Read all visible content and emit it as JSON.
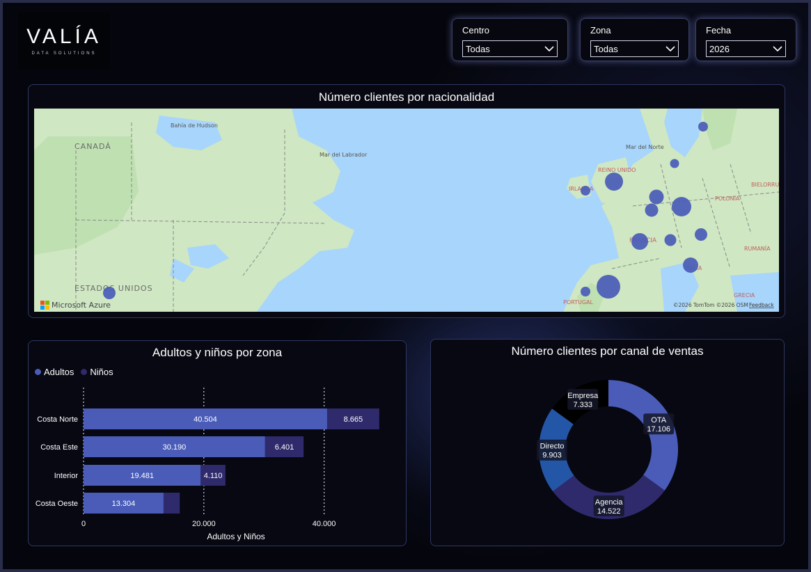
{
  "logo": {
    "main": "VALÍA",
    "sub": "DATA SOLUTIONS"
  },
  "slicers": [
    {
      "label": "Centro",
      "value": "Todas"
    },
    {
      "label": "Zona",
      "value": "Todas"
    },
    {
      "label": "Fecha",
      "value": "2026"
    }
  ],
  "map": {
    "title": "Número clientes por nacionalidad",
    "labels": {
      "bahia": "Bahía de Hudson",
      "canada": "CANADÁ",
      "labrador": "Mar del Labrador",
      "eeuu": "ESTADOS UNIDOS",
      "mar_norte": "Mar del Norte",
      "reino_unido": "REINO UNIDO",
      "irlanda": "IRLANDA",
      "francia": "FRANCIA",
      "italia": "ITALIA",
      "portugal": "PORTUGAL",
      "polonia": "POLONIA",
      "bielorrusia": "BIELORRU",
      "rumania": "RUMANÍA",
      "grecia": "GRECIA"
    },
    "attribution_left": "Microsoft Azure",
    "attribution_right": "©2026 TomTom  ©2026 OSM",
    "feedback": "Feedback",
    "bubble_color": "#4a5cb8"
  },
  "chart_bar": {
    "title": "Adultos y niños por zona",
    "xlabel": "Adultos y Niños",
    "ticks": [
      "0",
      "20.000",
      "40.000"
    ],
    "legend": [
      "Adultos",
      "Niños"
    ]
  },
  "chart_donut": {
    "title": "Número clientes por canal de ventas"
  },
  "chart_data": [
    {
      "type": "bar",
      "orientation": "horizontal",
      "stacked": true,
      "categories": [
        "Costa Norte",
        "Costa Este",
        "Interior",
        "Costa Oeste"
      ],
      "series": [
        {
          "name": "Adultos",
          "values": [
            40504,
            30190,
            19481,
            13304
          ],
          "color": "#4a5cb8",
          "labels": [
            "40.504",
            "30.190",
            "19.481",
            "13.304"
          ]
        },
        {
          "name": "Niños",
          "values": [
            8665,
            6401,
            4110,
            2700
          ],
          "color": "#2f2a6b",
          "labels": [
            "8.665",
            "6.401",
            "4.110",
            ""
          ]
        }
      ],
      "xlim": [
        0,
        50000
      ],
      "title": "Adultos y niños por zona",
      "xlabel": "Adultos y Niños"
    },
    {
      "type": "pie",
      "donut": true,
      "slices": [
        {
          "name": "OTA",
          "value": 17106,
          "label": "17.106",
          "color": "#4a5cb8"
        },
        {
          "name": "Agencia",
          "value": 14522,
          "label": "14.522",
          "color": "#2f2a6b"
        },
        {
          "name": "Directo",
          "value": 9903,
          "label": "9.903",
          "color": "#2456a8"
        },
        {
          "name": "Empresa",
          "value": 7333,
          "label": "7.333",
          "color": "#000000"
        }
      ],
      "title": "Número clientes por canal de ventas"
    }
  ]
}
